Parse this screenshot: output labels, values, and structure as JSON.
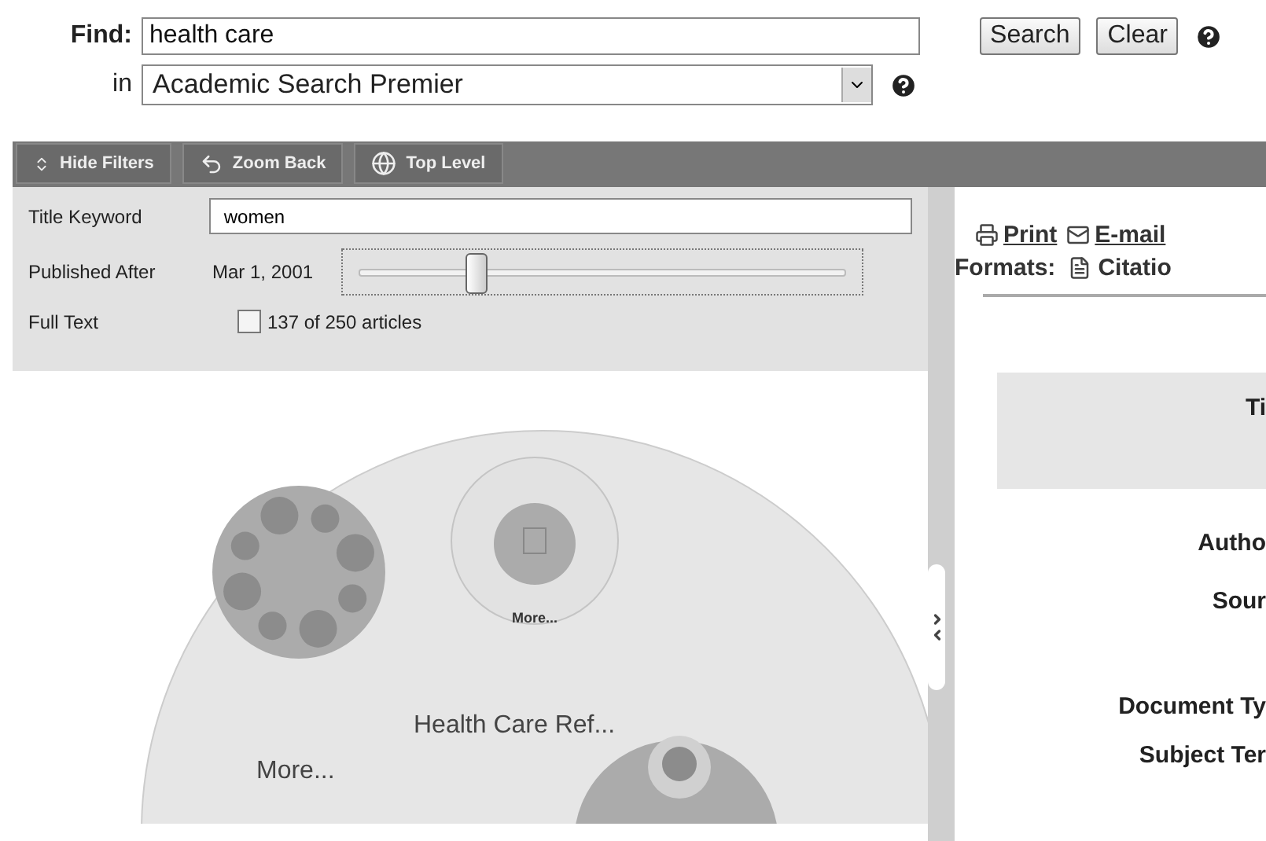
{
  "search": {
    "find_label": "Find:",
    "query": "health care",
    "search_button": "Search",
    "clear_button": "Clear",
    "in_label": "in",
    "database": "Academic Search Premier"
  },
  "toolbar": [
    {
      "kind": "toggle",
      "label": "Hide Filters"
    },
    {
      "kind": "back",
      "label": "Zoom Back"
    },
    {
      "kind": "top",
      "label": "Top Level"
    }
  ],
  "filters": {
    "title_keyword": {
      "label": "Title Keyword",
      "value": "women"
    },
    "published_after": {
      "label": "Published After",
      "value": "Mar 1, 2001",
      "level": 0.23
    },
    "full_text": {
      "label": "Full Text",
      "checked": false,
      "count": "137 of 250 articles"
    }
  },
  "map": {
    "inner_label": "More...",
    "cluster_label": "Health Care Ref...",
    "more_label": "More..."
  },
  "detail": {
    "actions": [
      {
        "kind": "print",
        "label": "Print"
      },
      {
        "kind": "email",
        "label": "E-mail"
      }
    ],
    "formats_label": "Formats:",
    "format": "Citatio",
    "title_label": "Ti",
    "fields": [
      "Autho",
      "Sour",
      "Document Ty",
      "Subject Ter"
    ]
  }
}
